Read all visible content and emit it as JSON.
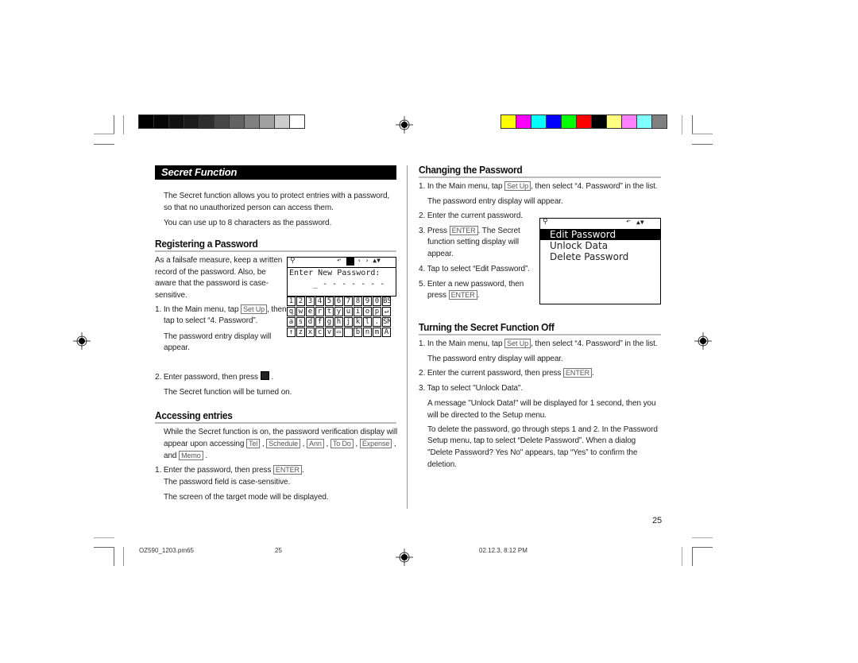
{
  "color_bars": {
    "grayscale": [
      "#000000",
      "#050505",
      "#111111",
      "#1c1c1c",
      "#2e2e2e",
      "#474747",
      "#636363",
      "#808080",
      "#a1a1a1",
      "#cccccc",
      "#ffffff"
    ],
    "color": [
      "#ffff00",
      "#ff00ff",
      "#00ffff",
      "#0000ff",
      "#00ff00",
      "#ff0000",
      "#000000",
      "#ffff80",
      "#ff80ff",
      "#80ffff",
      "#808080"
    ]
  },
  "left": {
    "section_title": "Secret Function",
    "intro": [
      "The Secret function allows you to protect entries with a password,",
      "so that no unauthorized person can access them.",
      "You can use up to 8 characters as the password."
    ],
    "registering": {
      "heading": "Registering a Password",
      "failsafe": [
        "As a failsafe measure, keep a written",
        "record of the password. Also, be",
        "aware that the password is case-",
        "sensitive."
      ],
      "step1_a": "1. In the Main menu, tap",
      "step1_key": "Set Up",
      "step1_b": ", then",
      "step1_c": "tap to select “4. Password”.",
      "step1_note": [
        "The password entry display will",
        "appear."
      ],
      "step2": "2. Enter password, then press",
      "step2_end": ".",
      "step2_note": "The Secret function will be turned on.",
      "lcd": {
        "prompt": "Enter New Password:",
        "mask": "_ - - - - - - -",
        "keys": [
          "1",
          "2",
          "3",
          "4",
          "5",
          "6",
          "7",
          "8",
          "9",
          "0",
          "BS",
          "q",
          "w",
          "e",
          "r",
          "t",
          "y",
          "u",
          "i",
          "o",
          "p",
          "↵",
          "a",
          "s",
          "d",
          "f",
          "g",
          "h",
          "j",
          "k",
          "l",
          ".",
          "SM",
          "↑",
          "z",
          "x",
          "c",
          "v",
          "▭",
          "",
          "b",
          "n",
          "m",
          "Ä"
        ]
      }
    },
    "accessing": {
      "heading": "Accessing entries",
      "line1": "While the Secret function is on, the password verification display will",
      "line2": "appear upon accessing",
      "keys": [
        "Tel",
        "Schedule",
        "Ann",
        "To Do",
        "Expense",
        "Memo"
      ],
      "and": "and",
      "step1": "1. Enter the password, then press",
      "enter_key": "ENTER",
      "note1": "The password field is case-sensitive.",
      "note2": "The screen of the target mode will be displayed."
    }
  },
  "right": {
    "changing": {
      "heading": "Changing the Password",
      "s1a": "1. In the Main menu, tap",
      "s1key": "Set Up",
      "s1b": ", then select “4. Password” in the list.",
      "s1note": "The password entry display will appear.",
      "s2": "2. Enter the current password.",
      "s3a": "3. Press",
      "s3key": "ENTER",
      "s3b": ". The Secret",
      "s3c": "function setting display will",
      "s3d": "appear.",
      "s4": "4. Tap to select “Edit Password”.",
      "s5a": "5. Enter a new password, then",
      "s5b": "press",
      "s5key": "ENTER",
      "menu": [
        "Edit Password",
        "Unlock Data",
        "Delete Password"
      ]
    },
    "turning_off": {
      "heading": "Turning the Secret Function Off",
      "s1a": "1. In the Main menu, tap",
      "s1key": "Set Up",
      "s1b": ", then select “4. Password” in the list.",
      "s1note": "The password entry display will appear.",
      "s2a": "2. Enter the current password, then press",
      "s2key": "ENTER",
      "s3": "3. Tap to select \"Unlock Data\".",
      "msg1": "A message \"Unlock Data!\" will be displayed for 1 second, then you",
      "msg2": "will be directed to the Setup menu.",
      "del1": "To delete the password, go through steps 1 and 2. In the Password",
      "del2": "Setup menu, tap to select “Delete Password”. When a dialog",
      "del3": "\"Delete Password? Yes No\" appears, tap “Yes” to confirm the",
      "del4": "deletion."
    }
  },
  "page_number": "25",
  "footer": {
    "file": "OZ590_1203.pm65",
    "page": "25",
    "date": "02.12.3, 8:12 PM"
  }
}
